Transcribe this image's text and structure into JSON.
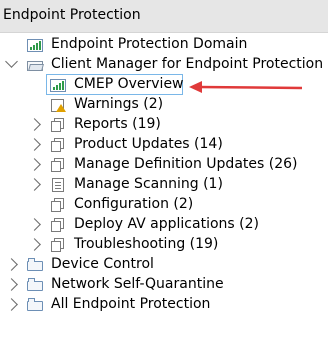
{
  "header": {
    "title": "Endpoint Protection"
  },
  "tree": {
    "items": [
      {
        "label": "Endpoint Protection Domain",
        "icon": "chart-icon"
      },
      {
        "label": "Client Manager for Endpoint Protection",
        "icon": "open-folder-icon",
        "state": "expanded"
      },
      {
        "label": "CMEP Overview",
        "icon": "chart-icon",
        "selected": true
      },
      {
        "label": "Warnings (2)",
        "icon": "warning-report-icon"
      },
      {
        "label": "Reports (19)",
        "icon": "reports-icon",
        "state": "collapsed"
      },
      {
        "label": "Product Updates (14)",
        "icon": "multi-doc-icon",
        "state": "collapsed"
      },
      {
        "label": "Manage Definition Updates (26)",
        "icon": "multi-doc-icon",
        "state": "collapsed"
      },
      {
        "label": "Manage Scanning (1)",
        "icon": "doc-icon",
        "state": "collapsed"
      },
      {
        "label": "Configuration (2)",
        "icon": "config-icon"
      },
      {
        "label": "Deploy AV applications (2)",
        "icon": "multi-doc-icon",
        "state": "collapsed"
      },
      {
        "label": "Troubleshooting (19)",
        "icon": "multi-doc-icon",
        "state": "collapsed"
      },
      {
        "label": "Device Control",
        "icon": "folder-icon",
        "state": "collapsed"
      },
      {
        "label": "Network Self-Quarantine",
        "icon": "folder-icon",
        "state": "collapsed"
      },
      {
        "label": "All Endpoint Protection",
        "icon": "folder-icon",
        "state": "collapsed"
      }
    ]
  },
  "annotation": {
    "arrow_color": "#e03a3a",
    "points_to": "CMEP Overview"
  },
  "colors": {
    "header_bg": "#e6e6e6",
    "selection_border": "#7ab7e8"
  }
}
